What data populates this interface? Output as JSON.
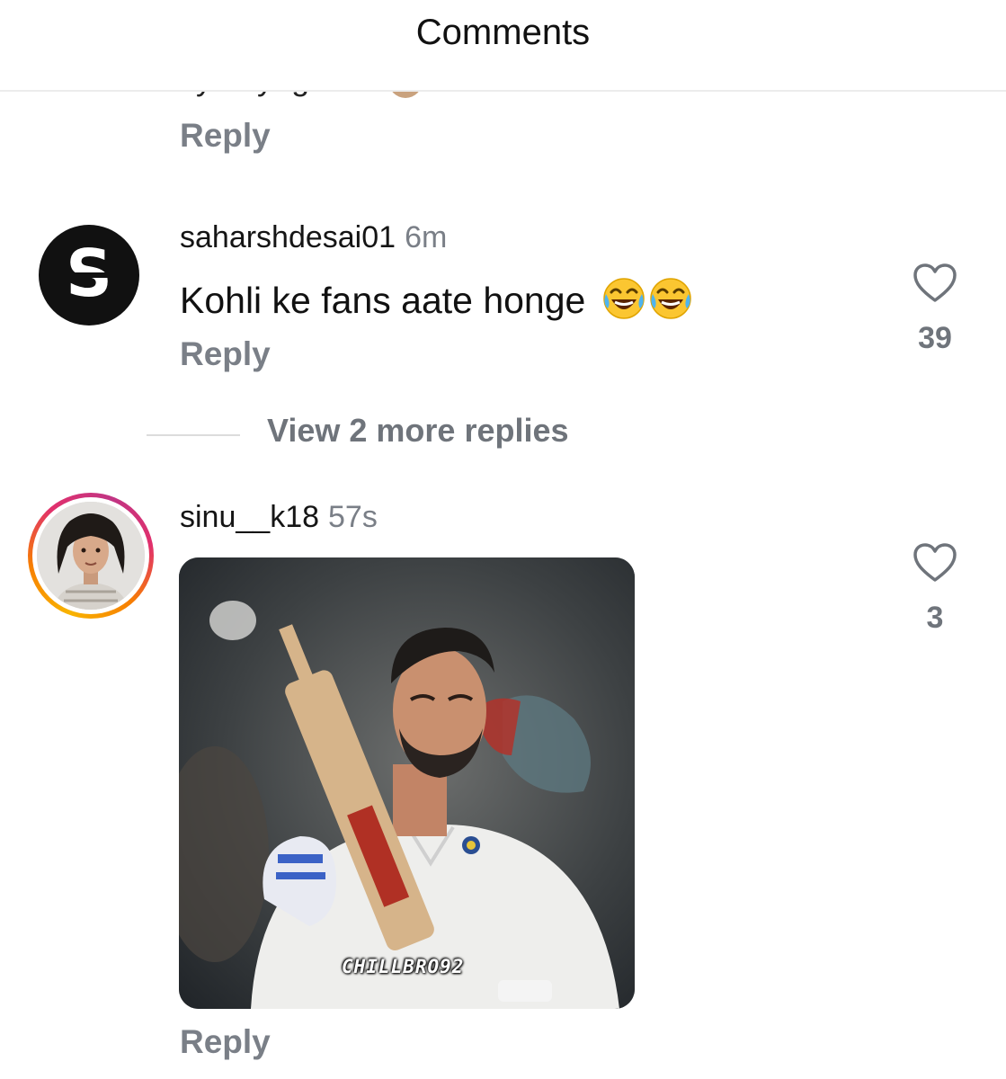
{
  "header": {
    "title": "Comments"
  },
  "previous_comment": {
    "clipped_text": "ılyo ayegam...",
    "reply_label": "Reply"
  },
  "comments": [
    {
      "username": "saharshdesai01",
      "time": "6m",
      "text": "Kohli ke fans aate honge",
      "emojis": "😂😂",
      "avatar_letter": "S",
      "likes": "39",
      "reply_label": "Reply",
      "view_replies_label": "View 2 more replies"
    },
    {
      "username": "sinu__k18",
      "time": "57s",
      "gif_watermark": "CHILLBRO92",
      "likes": "3",
      "reply_label": "Reply"
    }
  ],
  "icons": {
    "like": "heart-outline-icon",
    "laugh": "face-with-tears-of-joy-icon"
  },
  "colors": {
    "secondary_text": "#7a7f87",
    "story_ring_start": "#f8b400",
    "story_ring_end": "#c13584"
  }
}
